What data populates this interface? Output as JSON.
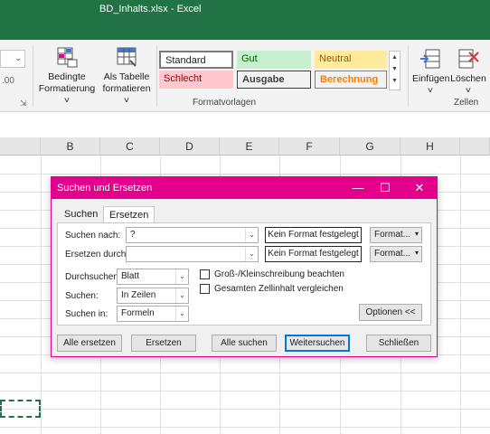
{
  "window": {
    "title": "BD_Inhalts.xlsx  -  Excel"
  },
  "ribbon": {
    "conditional_format": {
      "line1": "Bedingte",
      "line2": "Formatierung ˅"
    },
    "format_table": {
      "line1": "Als Tabelle",
      "line2": "formatieren ˅"
    },
    "styles": {
      "standard": "Standard",
      "gut": "Gut",
      "neutral": "Neutral",
      "schlecht": "Schlecht",
      "ausgabe": "Ausgabe",
      "berechnung": "Berechnung"
    },
    "styles_group_label": "Formatvorlagen",
    "insert": {
      "line1": "Einfügen",
      "line2": "˅"
    },
    "delete": {
      "line1": "Löschen",
      "line2": "˅"
    },
    "cells_group_label": "Zellen",
    "colors": {
      "accent": "#217346",
      "dialog_accent": "#e3008c"
    }
  },
  "sheet": {
    "columns": [
      "B",
      "C",
      "D",
      "E",
      "F",
      "G",
      "H"
    ]
  },
  "dialog": {
    "title": "Suchen und Ersetzen",
    "tabs": {
      "suchen": "Suchen",
      "ersetzen": "Ersetzen"
    },
    "search_label": "Suchen nach:",
    "search_value": "?",
    "replace_label": "Ersetzen durch:",
    "replace_value": "",
    "no_format": "Kein Format festgelegt",
    "format_button": "Format...",
    "search_in_label": "Durchsuchen:",
    "search_in_value": "Blatt",
    "search_order_label": "Suchen:",
    "search_order_value": "In Zeilen",
    "look_in_label": "Suchen in:",
    "look_in_value": "Formeln",
    "match_case": "Groß-/Kleinschreibung beachten",
    "match_entire": "Gesamten Zellinhalt vergleichen",
    "options_button": "Optionen <<",
    "buttons": {
      "replace_all": "Alle ersetzen",
      "replace": "Ersetzen",
      "find_all": "Alle suchen",
      "find_next": "Weitersuchen",
      "close": "Schließen"
    }
  }
}
